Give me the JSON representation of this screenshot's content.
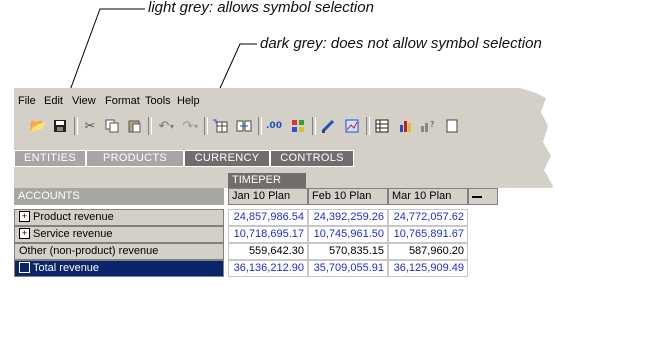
{
  "annotations": {
    "light": "light grey: allows symbol selection",
    "dark": "dark grey: does not allow symbol selection"
  },
  "menu": [
    "File",
    "Edit",
    "View",
    "Format",
    "Tools",
    "Help"
  ],
  "toolbar": {
    "icons": [
      "open-folder-icon",
      "save-icon",
      "cut-icon",
      "copy-icon",
      "paste-icon",
      "undo-icon",
      "redo-icon",
      "pivot-icon",
      "swap-icon",
      "decimal-icon",
      "color-icon",
      "edit-icon",
      "chart-icon",
      "grid-icon",
      "bar-chart-icon",
      "help-chart-icon",
      "export-icon"
    ]
  },
  "dimensions": [
    {
      "label": "ENTITIES",
      "shade": "light"
    },
    {
      "label": "PRODUCTS",
      "shade": "light"
    },
    {
      "label": "CURRENCY",
      "shade": "dark"
    },
    {
      "label": "CONTROLS",
      "shade": "dark"
    }
  ],
  "column_dimension": "TIMEPER",
  "row_dimension": "ACCOUNTS",
  "columns": [
    "Jan 10 Plan",
    "Feb 10 Plan",
    "Mar 10 Plan"
  ],
  "rows": [
    {
      "label": "Product revenue",
      "expand": "+",
      "values": [
        "24,857,986.54",
        "24,392,259.26",
        "24,772,057.62"
      ],
      "color": "blue"
    },
    {
      "label": "Service revenue",
      "expand": "+",
      "values": [
        "10,718,695.17",
        "10,745,961.50",
        "10,765,891.67"
      ],
      "color": "blue"
    },
    {
      "label": "Other (non-product) revenue",
      "expand": "",
      "values": [
        "559,642.30",
        "570,835.15",
        "587,960.20"
      ],
      "color": "black"
    },
    {
      "label": "Total revenue",
      "expand": "-",
      "values": [
        "36,136,212.90",
        "35,709,055.91",
        "36,125,909.49"
      ],
      "color": "blue",
      "selected": true
    }
  ],
  "colors": {
    "window": "#d4d0c8",
    "light_grey": "#a7a6a3",
    "dark_grey": "#6f6e6c",
    "selection": "#0a246a",
    "value_blue": "#1f2fd0"
  }
}
